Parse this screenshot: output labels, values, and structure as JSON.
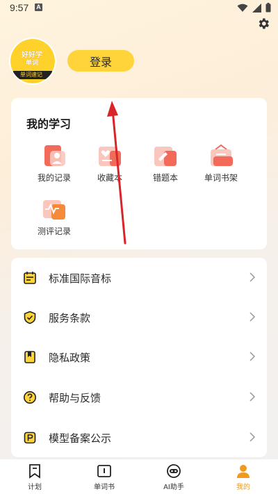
{
  "status_bar": {
    "time": "9:57",
    "notif": "A"
  },
  "avatar": {
    "line1": "好好学",
    "line2": "单词",
    "band": "单词速记"
  },
  "login_label": "登录",
  "study": {
    "title": "我的学习",
    "items": [
      {
        "label": "我的记录",
        "icon": "record-icon"
      },
      {
        "label": "收藏本",
        "icon": "favorites-icon"
      },
      {
        "label": "错题本",
        "icon": "mistakes-icon"
      },
      {
        "label": "单词书架",
        "icon": "bookshelf-icon"
      },
      {
        "label": "测评记录",
        "icon": "assessment-icon"
      }
    ]
  },
  "menu": [
    {
      "label": "标准国际音标",
      "icon": "calendar-icon"
    },
    {
      "label": "服务条款",
      "icon": "shield-check-icon"
    },
    {
      "label": "隐私政策",
      "icon": "bookmark-icon"
    },
    {
      "label": "帮助与反馈",
      "icon": "question-icon"
    },
    {
      "label": "模型备案公示",
      "icon": "p-icon"
    }
  ],
  "tabs": [
    {
      "label": "计划",
      "icon": "flag-icon"
    },
    {
      "label": "单词书",
      "icon": "book-icon"
    },
    {
      "label": "AI助手",
      "icon": "robot-icon"
    },
    {
      "label": "我的",
      "icon": "profile-icon"
    }
  ],
  "colors": {
    "accent": "#ffd43a",
    "active_tab": "#f39a1e",
    "icon_red": "#f26a5a",
    "annotation": "#d9252a"
  }
}
